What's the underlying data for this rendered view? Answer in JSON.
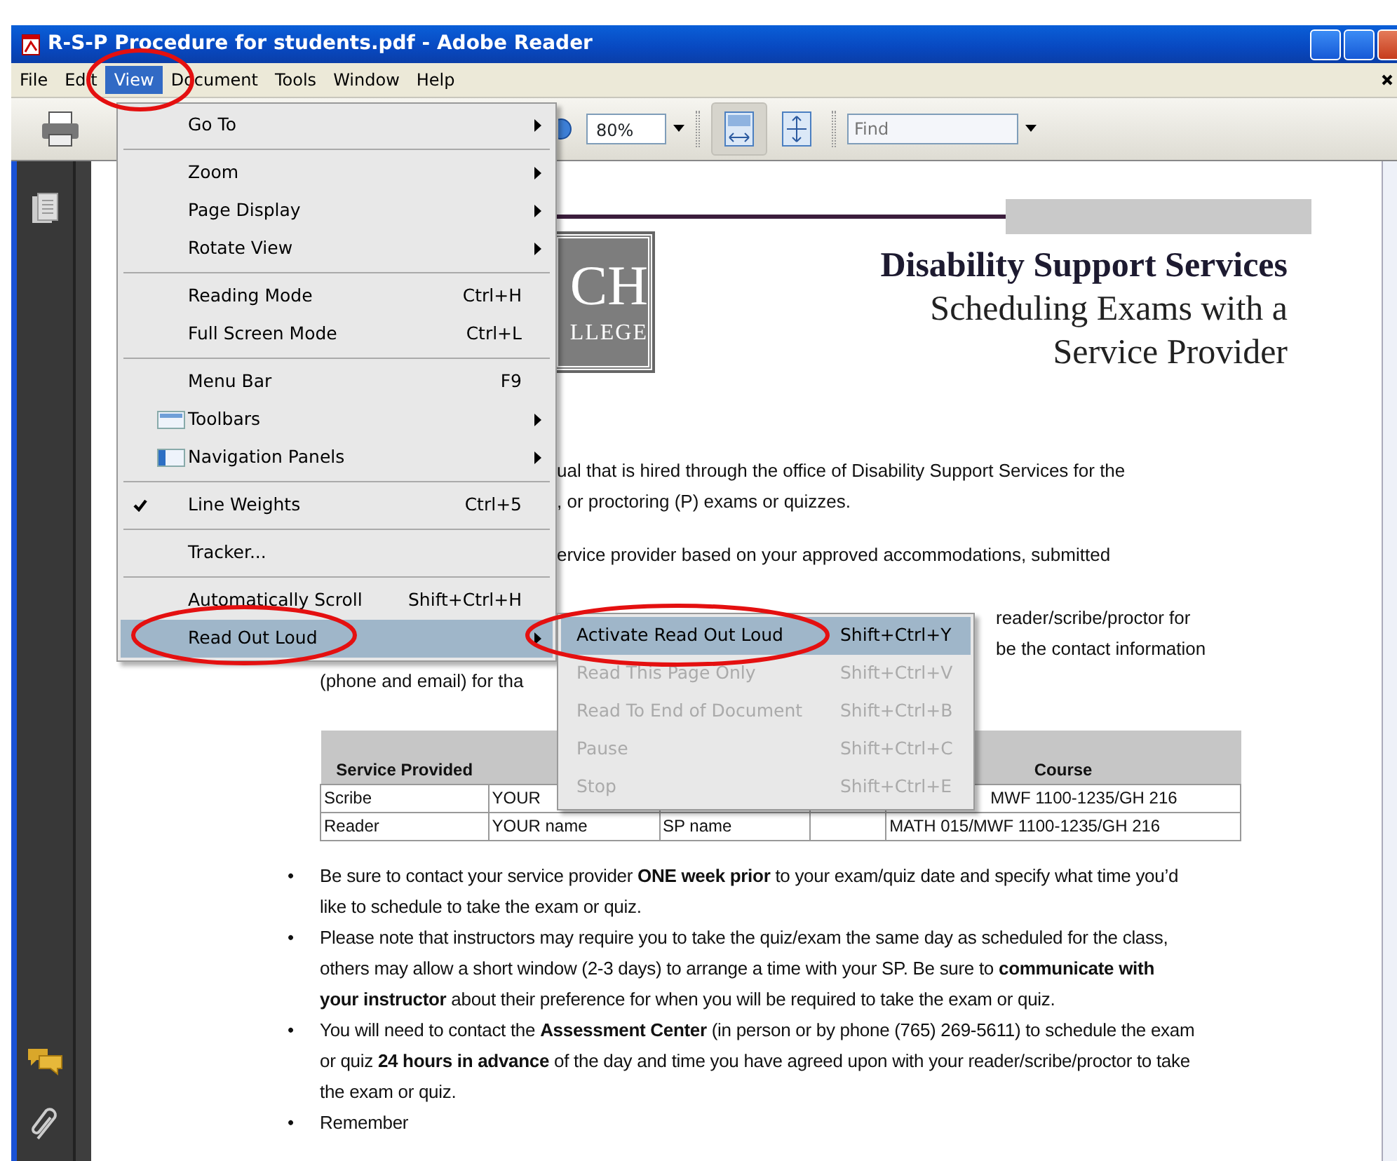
{
  "window": {
    "title": "R-S-P Procedure for students.pdf - Adobe Reader"
  },
  "menu_bar": [
    {
      "label": "File",
      "selected": false
    },
    {
      "label": "Edit",
      "selected": false
    },
    {
      "label": "View",
      "selected": true
    },
    {
      "label": "Document",
      "selected": false
    },
    {
      "label": "Tools",
      "selected": false
    },
    {
      "label": "Window",
      "selected": false
    },
    {
      "label": "Help",
      "selected": false
    }
  ],
  "toolbar": {
    "zoom": "80%",
    "find_placeholder": "Find",
    "fit_width_pressed": true
  },
  "view_menu": [
    [
      {
        "label": "Go To",
        "submenu": true,
        "checked": false,
        "selected": false,
        "kind": "plain"
      }
    ],
    [
      {
        "label": "Zoom",
        "submenu": true,
        "checked": false,
        "selected": false,
        "kind": "plain"
      },
      {
        "label": "Page Display",
        "submenu": true,
        "checked": false,
        "selected": false,
        "kind": "plain"
      },
      {
        "label": "Rotate View",
        "submenu": true,
        "checked": false,
        "selected": false,
        "kind": "plain"
      }
    ],
    [
      {
        "label": "Reading Mode",
        "shortcut": "Ctrl+H",
        "submenu": false,
        "checked": false,
        "selected": false,
        "kind": "plain"
      },
      {
        "label": "Full Screen Mode",
        "shortcut": "Ctrl+L",
        "submenu": false,
        "checked": false,
        "selected": false,
        "kind": "plain"
      }
    ],
    [
      {
        "label": "Menu Bar",
        "shortcut": "F9",
        "submenu": false,
        "checked": false,
        "selected": false,
        "kind": "plain"
      },
      {
        "label": "Toolbars",
        "submenu": true,
        "checked": false,
        "selected": false,
        "kind": "toolbar"
      },
      {
        "label": "Navigation Panels",
        "submenu": true,
        "checked": false,
        "selected": false,
        "kind": "panel"
      }
    ],
    [
      {
        "label": "Line Weights",
        "shortcut": "Ctrl+5",
        "submenu": false,
        "checked": true,
        "selected": false,
        "kind": "plain"
      }
    ],
    [
      {
        "label": "Tracker...",
        "submenu": false,
        "checked": false,
        "selected": false,
        "kind": "plain"
      }
    ],
    [
      {
        "label": "Automatically Scroll",
        "shortcut": "Shift+Ctrl+H",
        "submenu": false,
        "checked": false,
        "selected": false,
        "kind": "plain"
      },
      {
        "label": "Read Out Loud",
        "submenu": true,
        "checked": false,
        "selected": true,
        "kind": "plain"
      }
    ]
  ],
  "read_out_loud_menu": [
    {
      "label": "Activate Read Out Loud",
      "shortcut": "Shift+Ctrl+Y",
      "disabled": false,
      "selected": true
    },
    {
      "label": "Read This Page Only",
      "shortcut": "Shift+Ctrl+V",
      "disabled": true,
      "selected": false
    },
    {
      "label": "Read To End of Document",
      "shortcut": "Shift+Ctrl+B",
      "disabled": true,
      "selected": false
    },
    {
      "label": "Pause",
      "shortcut": "Shift+Ctrl+C",
      "disabled": true,
      "selected": false
    },
    {
      "label": "Stop",
      "shortcut": "Shift+Ctrl+E",
      "disabled": true,
      "selected": false
    }
  ],
  "document": {
    "logo": [
      "CH",
      "LLEGE"
    ],
    "title": "Disability Support Services",
    "subtitle": [
      "Scheduling Exams with a",
      "Service Provider"
    ],
    "fragments": [
      {
        "text": "ual that is hired through the office of Disability Support Services for the",
        "kind": "right"
      },
      {
        "text": ", or proctoring (P) exams or quizzes.",
        "kind": "right"
      },
      {
        "text": "ervice provider based on your approved accommodations, submitted",
        "kind": "right-gap"
      },
      {
        "text": "reader/scribe/proctor for",
        "kind": "far"
      },
      {
        "text": "be the contact information",
        "kind": "farther"
      },
      {
        "text": "(phone and email) for tha",
        "kind": "full"
      }
    ],
    "table": {
      "columns": [
        "Service Provided",
        "",
        "",
        "",
        "Course"
      ],
      "rows": [
        [
          "Scribe",
          "YOUR",
          "",
          "",
          "MWF 1100-1235/GH 216"
        ],
        [
          "Reader",
          "YOUR name",
          "SP name",
          "",
          "MATH 015/MWF 1100-1235/GH 216"
        ]
      ]
    },
    "bullets": [
      {
        "mark": "•",
        "text": "Be sure to contact your service provider **ONE week prior** to your exam/quiz date and specify what time you’d like to schedule to take the exam or quiz."
      },
      {
        "mark": "•",
        "text": "Please note that instructors may require you to take the quiz/exam the same day as scheduled for the class, others may allow a short window (2-3 days) to arrange a time with your SP.  Be sure to **communicate with your instructor** about their preference for when you will be required to take the exam or quiz."
      },
      {
        "mark": "•",
        "text": "You will need to contact the **Assessment Center** (in person or by phone (765) 269-5611) to schedule the exam or quiz **24 hours in advance** of the day and time you have agreed upon with your reader/scribe/proctor to take the exam or quiz."
      },
      {
        "mark": "•",
        "text": "Remember"
      }
    ]
  }
}
